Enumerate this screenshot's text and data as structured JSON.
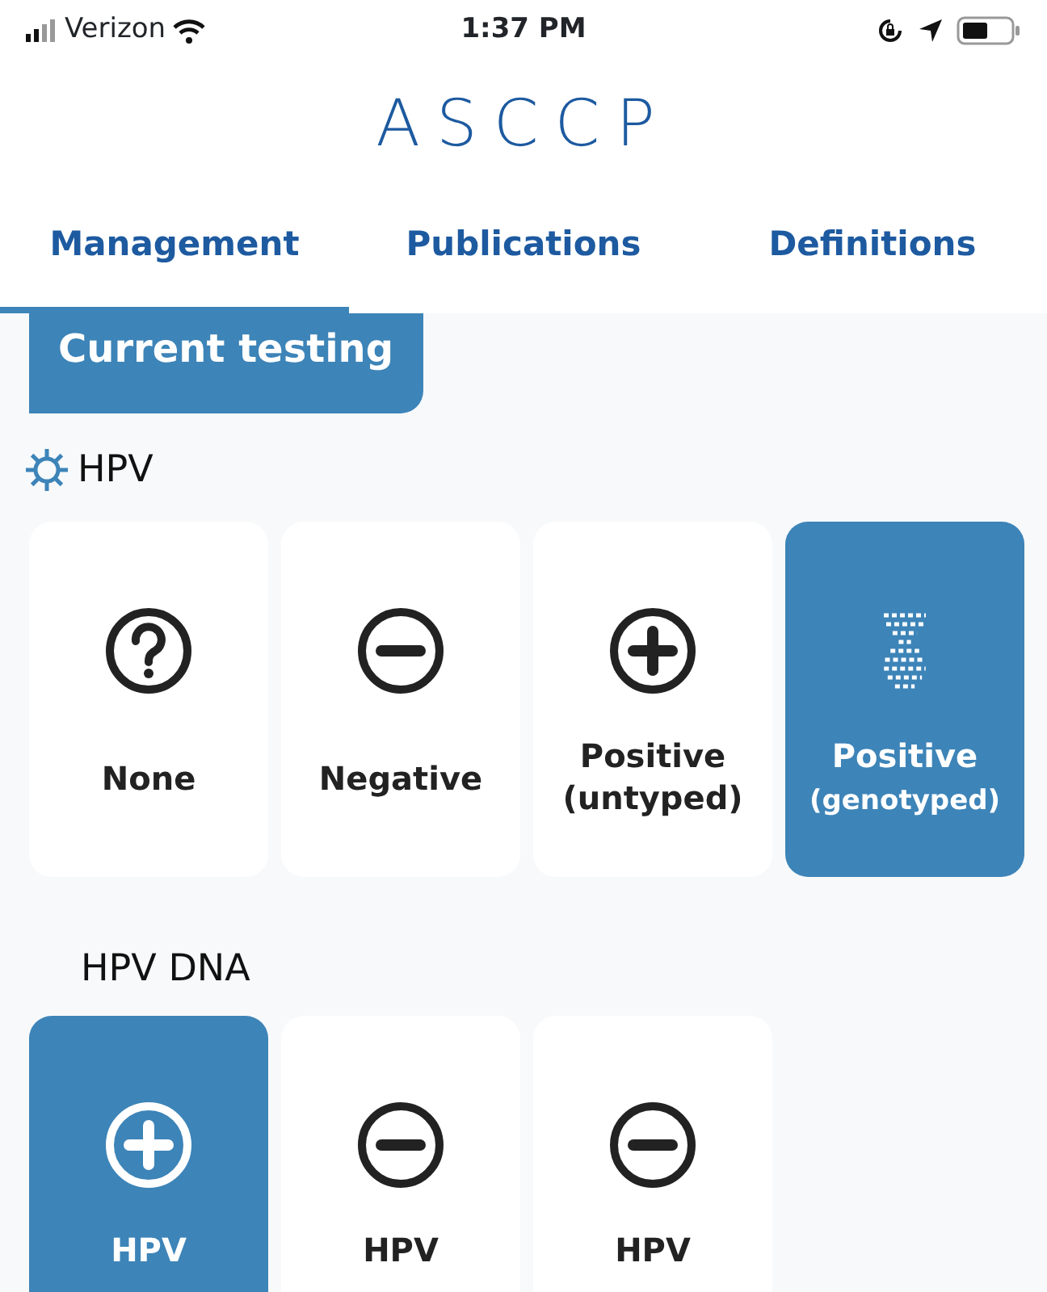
{
  "status_bar": {
    "carrier": "Verizon",
    "time": "1:37 PM"
  },
  "logo": {
    "text": "ASCCP"
  },
  "tabs": [
    {
      "label": "Management",
      "selected": true
    },
    {
      "label": "Publications",
      "selected": false
    },
    {
      "label": "Definitions",
      "selected": false
    }
  ],
  "section_title": "Current testing",
  "groups": [
    {
      "title": "HPV",
      "kind": "virus",
      "options": [
        {
          "kind": "question",
          "label": "None",
          "selected": false
        },
        {
          "kind": "minus",
          "label": "Negative",
          "selected": false
        },
        {
          "kind": "plus",
          "label": "Positive",
          "sublabel": "(untyped)",
          "selected": false
        },
        {
          "kind": "dna",
          "label": "Positive",
          "sublabel": "(genotyped)",
          "selected": true
        }
      ]
    },
    {
      "title": "HPV DNA",
      "kind": "plain",
      "options": [
        {
          "kind": "plus",
          "label": "HPV",
          "selected": true
        },
        {
          "kind": "minus",
          "label": "HPV",
          "selected": false
        },
        {
          "kind": "minus",
          "label": "HPV",
          "selected": false
        }
      ]
    }
  ]
}
